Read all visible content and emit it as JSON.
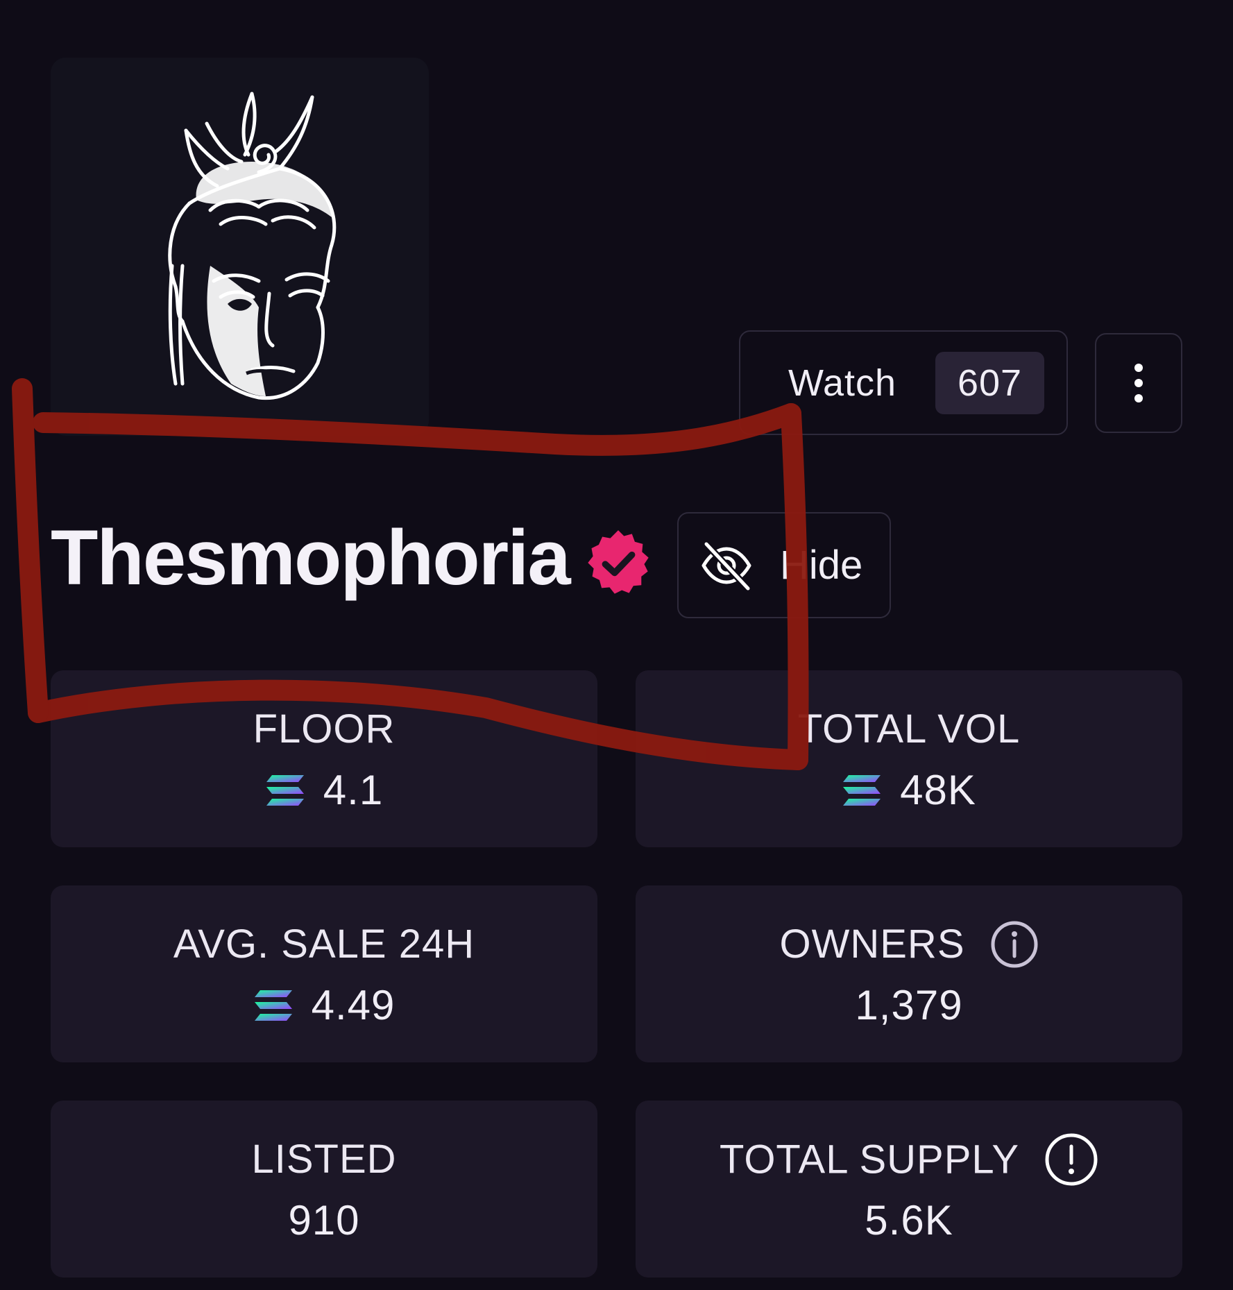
{
  "collection": {
    "name": "Thesmophoria",
    "image_icon": "crowned-face-portrait",
    "verified": true,
    "verified_color": "#e8266f"
  },
  "actions": {
    "watch_label": "Watch",
    "watch_count": "607",
    "more_icon": "vertical-ellipsis-icon",
    "hide_label": "Hide",
    "hide_icon": "eye-off-icon"
  },
  "stats": [
    {
      "label": "FLOOR",
      "value": "4.1",
      "currency_icon": "solana-icon"
    },
    {
      "label": "TOTAL VOL",
      "value": "48K",
      "currency_icon": "solana-icon"
    },
    {
      "label": "AVG. SALE 24H",
      "value": "4.49",
      "currency_icon": "solana-icon"
    },
    {
      "label": "OWNERS",
      "value": "1,379",
      "extra_icon": "info-icon"
    },
    {
      "label": "LISTED",
      "value": "910"
    },
    {
      "label": "TOTAL SUPPLY",
      "value": "5.6K",
      "extra_icon": "alert-icon"
    }
  ],
  "colors": {
    "background": "#0f0c17",
    "card": "#1c1727",
    "border": "#2e2a3b",
    "annotation_red": "#8b1a10"
  }
}
